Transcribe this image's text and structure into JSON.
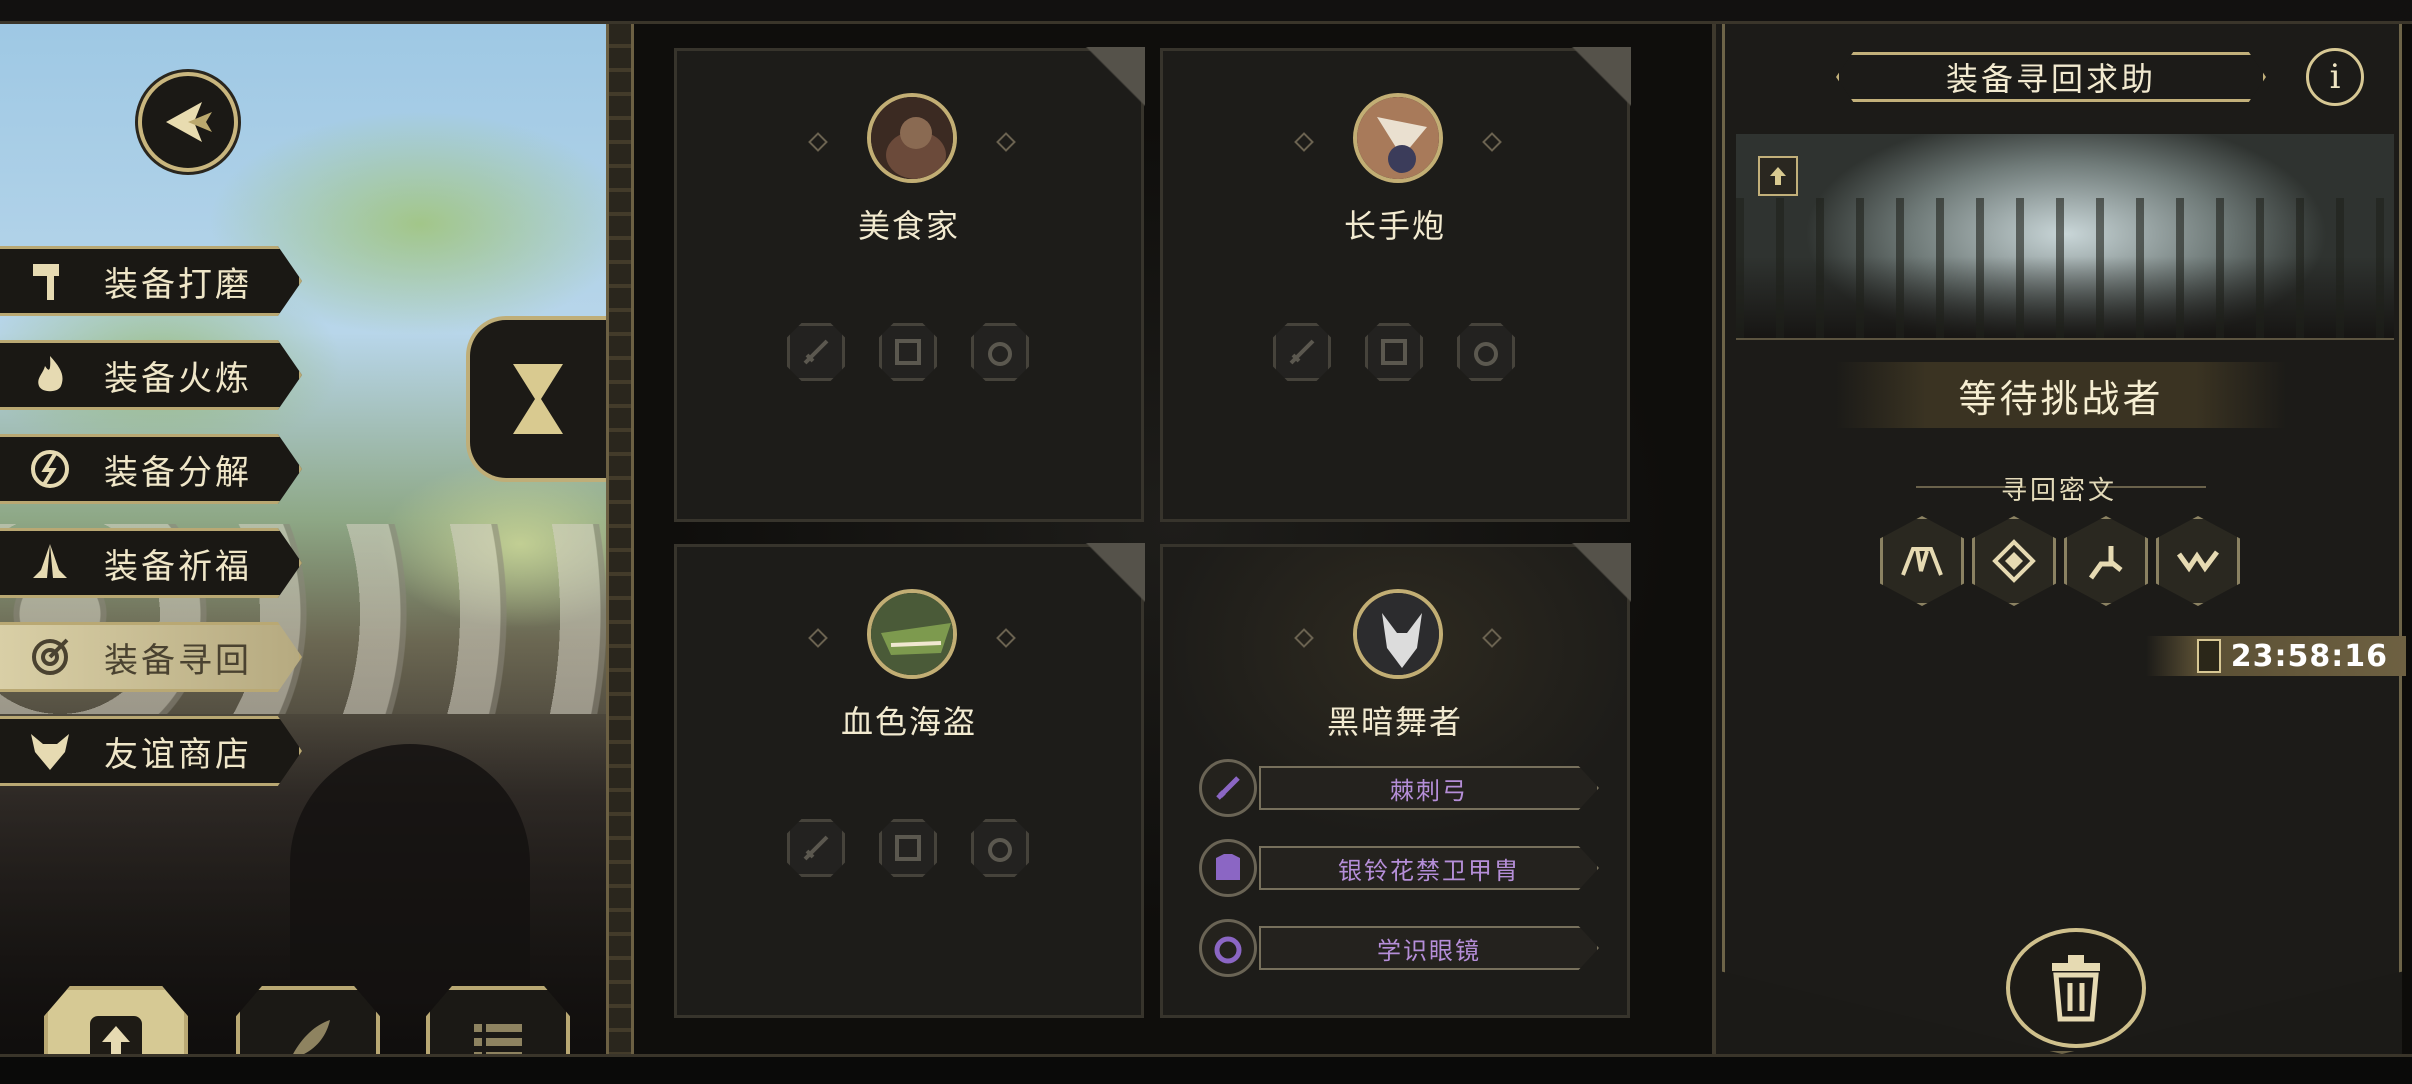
{
  "menu": {
    "items": [
      {
        "label": "装备打磨",
        "icon": "hammer-icon"
      },
      {
        "label": "装备火炼",
        "icon": "flame-icon"
      },
      {
        "label": "装备分解",
        "icon": "break-icon"
      },
      {
        "label": "装备祈福",
        "icon": "prayer-icon"
      },
      {
        "label": "装备寻回",
        "icon": "target-icon",
        "active": true
      },
      {
        "label": "友谊商店",
        "icon": "fox-icon"
      }
    ]
  },
  "characters": [
    {
      "name": "美食家"
    },
    {
      "name": "长手炮"
    },
    {
      "name": "血色海盗"
    },
    {
      "name": "黑暗舞者",
      "equipment": [
        "棘刺弓",
        "银铃花禁卫甲胄",
        "学识眼镜"
      ]
    }
  ],
  "panel": {
    "title": "装备寻回求助",
    "info": "i",
    "status": "等待挑战者",
    "cipher_label": "寻回密文",
    "timer": "23:58:16"
  },
  "colors": {
    "gold": "#c2b07a",
    "item_text": "#b58ed8",
    "panel_bg": "#1b1a17"
  }
}
